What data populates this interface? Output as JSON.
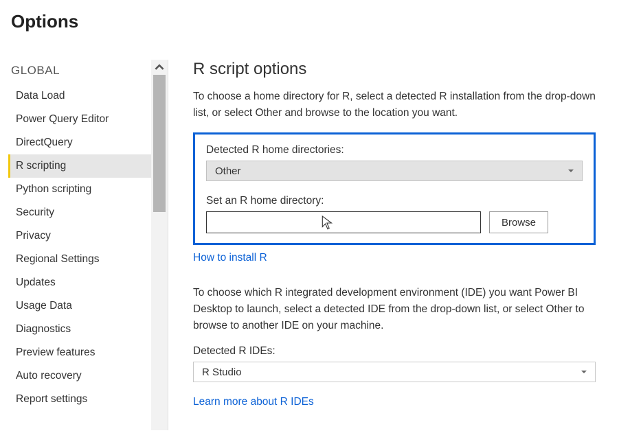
{
  "title": "Options",
  "sidebar": {
    "section": "GLOBAL",
    "items": [
      {
        "label": "Data Load"
      },
      {
        "label": "Power Query Editor"
      },
      {
        "label": "DirectQuery"
      },
      {
        "label": "R scripting",
        "active": true
      },
      {
        "label": "Python scripting"
      },
      {
        "label": "Security"
      },
      {
        "label": "Privacy"
      },
      {
        "label": "Regional Settings"
      },
      {
        "label": "Updates"
      },
      {
        "label": "Usage Data"
      },
      {
        "label": "Diagnostics"
      },
      {
        "label": "Preview features"
      },
      {
        "label": "Auto recovery"
      },
      {
        "label": "Report settings"
      }
    ]
  },
  "content": {
    "heading": "R script options",
    "intro": "To choose a home directory for R, select a detected R installation from the drop-down list, or select Other and browse to the location you want.",
    "detected_home_label": "Detected R home directories:",
    "detected_home_value": "Other",
    "set_home_label": "Set an R home directory:",
    "set_home_value": "",
    "browse_label": "Browse",
    "install_link": "How to install R",
    "ide_intro": "To choose which R integrated development environment (IDE) you want Power BI Desktop to launch, select a detected IDE from the drop-down list, or select Other to browse to another IDE on your machine.",
    "detected_ide_label": "Detected R IDEs:",
    "detected_ide_value": "R Studio",
    "ide_link": "Learn more about R IDEs"
  }
}
